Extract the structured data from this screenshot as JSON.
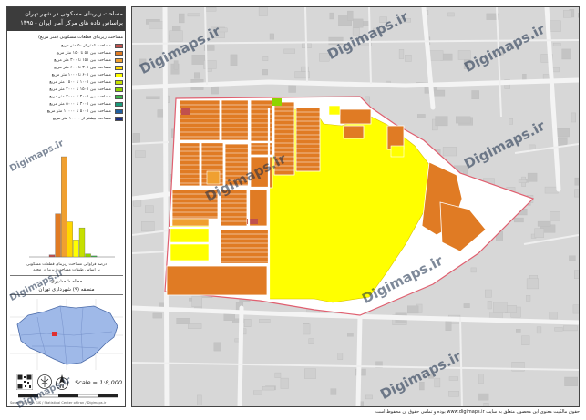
{
  "panel": {
    "title_line1": "مساحت زیربنای مسکونی در شهر تهران",
    "title_line2": "براساس داده های مرکز آمار ایران - ۱۳۹۵",
    "legend_heading": "مساحت زیربنای قطعات مسکونی (متر مربع)",
    "legend": [
      {
        "label": "مساحت کمتر از ۵۰ متر مربع",
        "color": "#c0504d"
      },
      {
        "label": "مساحت بین ۵۱ تا ۱۵۰ متر مربع",
        "color": "#e07b24"
      },
      {
        "label": "مساحت بین ۱۵۱ تا ۳۰۰ متر مربع",
        "color": "#f0a030"
      },
      {
        "label": "مساحت بین ۳۰۱ تا ۶۰۰ متر مربع",
        "color": "#ffd700"
      },
      {
        "label": "مساحت بین ۶۰۱ تا ۱۰۰۰ متر مربع",
        "color": "#ffff00"
      },
      {
        "label": "مساحت بین ۱۰۰۱ تا ۱۵۰۰ متر مربع",
        "color": "#c6e000"
      },
      {
        "label": "مساحت بین ۱۵۰۱ تا ۲۰۰۰ متر مربع",
        "color": "#8ed400"
      },
      {
        "label": "مساحت بین ۲۰۰۱ تا ۳۰۰۰ متر مربع",
        "color": "#3cb44b"
      },
      {
        "label": "مساحت بین ۳۰۰۱ تا ۵۰۰۰ متر مربع",
        "color": "#1a9a7a"
      },
      {
        "label": "مساحت بین ۵۰۰۱ تا ۱۰۰۰۰ متر مربع",
        "color": "#1f5fa0"
      },
      {
        "label": "مساحت بیشتر از ۱۰۰۰۰ متر مربع",
        "color": "#1c2f80"
      }
    ],
    "histogram_caption_line1": "درصد فراوانی مساحت زیربنای قطعات مسکونی",
    "histogram_caption_line2": "بر اساس طبقات مساحت زیربنا در محله",
    "location_line1": "محله شمشیری",
    "location_line2": "منطقه (۹) شهرداری تهران",
    "scale_label": "Scale = 1:8,000",
    "credits": "Source: Tehran GIS / Statistical Center of Iran / Digimaps.ir"
  },
  "chart_data": {
    "type": "bar",
    "categories": [
      "<50",
      "51-150",
      "151-300",
      "301-600",
      "601-1000",
      "1001-1500",
      "1501-2000",
      "2001-3000",
      "3001-5000",
      "5001-10000",
      ">10000"
    ],
    "values": [
      2,
      43,
      100,
      35,
      17,
      29,
      3,
      1,
      0,
      0,
      0
    ],
    "colors": [
      "#c0504d",
      "#e07b24",
      "#f0a030",
      "#ffd700",
      "#ffff00",
      "#c6e000",
      "#8ed400",
      "#3cb44b",
      "#1a9a7a",
      "#1f5fa0",
      "#1c2f80"
    ],
    "ylim": [
      0,
      100
    ],
    "xlabel": "",
    "ylabel": "",
    "grid": false
  },
  "map": {
    "watermark": "Digimaps.ir",
    "footer": "حقوق مالکیت معنوی این محصول متعلق به سایت www.digimaps.ir بوده و تمامی حقوق آن محفوظ است."
  }
}
